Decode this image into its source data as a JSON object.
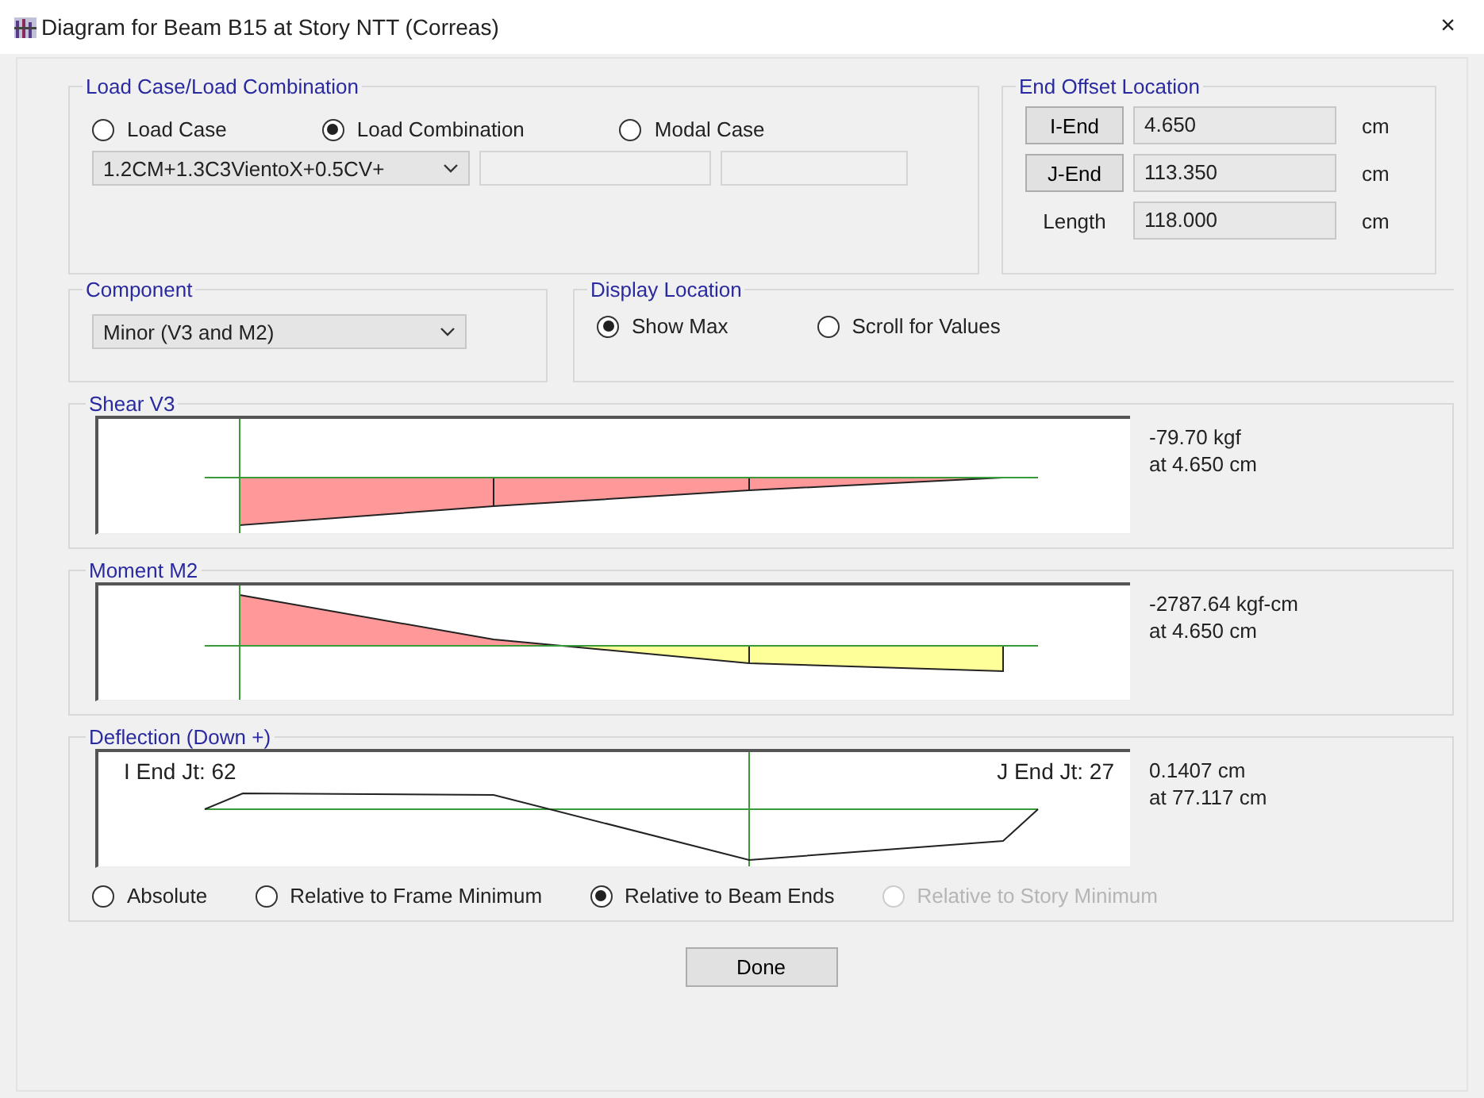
{
  "window": {
    "title": "Diagram for Beam B15 at Story NTT (Correas)",
    "close": "×"
  },
  "load_case": {
    "title": "Load Case/Load Combination",
    "options": [
      {
        "label": "Load Case",
        "selected": false
      },
      {
        "label": "Load Combination",
        "selected": true
      },
      {
        "label": "Modal Case",
        "selected": false
      }
    ],
    "combo": "1.2CM+1.3C3VientoX+0.5CV+"
  },
  "end_offset": {
    "title": "End Offset Location",
    "rows": [
      {
        "kind": "button",
        "label": "I-End",
        "value": "4.650",
        "unit": "cm"
      },
      {
        "kind": "button",
        "label": "J-End",
        "value": "113.350",
        "unit": "cm"
      },
      {
        "kind": "label",
        "label": "Length",
        "value": "118.000",
        "unit": "cm"
      }
    ]
  },
  "component": {
    "title": "Component",
    "value": "Minor (V3 and M2)"
  },
  "display_location": {
    "title": "Display Location",
    "options": [
      {
        "label": "Show Max",
        "selected": true
      },
      {
        "label": "Scroll for Values",
        "selected": false
      }
    ]
  },
  "shear": {
    "title": "Shear V3",
    "value": "-79.70 kgf",
    "location": "at 4.650 cm"
  },
  "moment": {
    "title": "Moment M2",
    "value": "-2787.64 kgf-cm",
    "location": "at 4.650 cm"
  },
  "deflection": {
    "title": "Deflection (Down +)",
    "i_end": "I End Jt: 62",
    "j_end": "J End Jt: 27",
    "value": "0.1407 cm",
    "location": "at 77.117 cm",
    "options": [
      {
        "label": "Absolute",
        "selected": false,
        "disabled": false
      },
      {
        "label": "Relative to Frame Minimum",
        "selected": false,
        "disabled": false
      },
      {
        "label": "Relative to Beam Ends",
        "selected": true,
        "disabled": false
      },
      {
        "label": "Relative to Story Minimum",
        "selected": false,
        "disabled": true
      }
    ]
  },
  "done": "Done"
}
